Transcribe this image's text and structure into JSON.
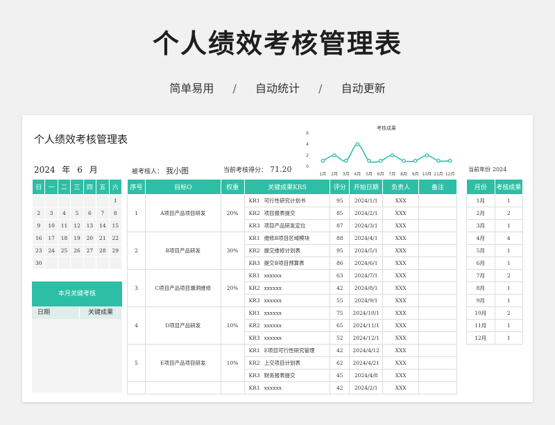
{
  "hero": {
    "title": "个人绩效考核管理表",
    "tag1": "简单易用",
    "tag2": "自动统计",
    "tag3": "自动更新",
    "sep": "/"
  },
  "sheet": {
    "title": "个人绩效考核管理表",
    "year": "2024",
    "year_unit": "年",
    "month": "6",
    "month_unit": "月",
    "assessee_label": "被考核人：",
    "assessee": "我小图",
    "score_label": "当前考核得分：",
    "score": "71.20",
    "curyear_label": "当前年份",
    "curyear": "2024"
  },
  "chart_data": {
    "type": "line",
    "title": "考核成果",
    "categories": [
      "1月",
      "2月",
      "3月",
      "4月",
      "5月",
      "6月",
      "7月",
      "8月",
      "9月",
      "10月",
      "11月",
      "12月"
    ],
    "values": [
      1,
      2,
      1,
      4,
      1,
      1,
      2,
      1,
      1,
      2,
      1,
      1
    ],
    "ylim": [
      0,
      6
    ],
    "yticks": [
      "0",
      "2",
      "4",
      "6"
    ],
    "color": "#2dbfa5"
  },
  "calendar": {
    "headers": [
      "日",
      "一",
      "二",
      "三",
      "四",
      "五",
      "六"
    ],
    "weeks": [
      [
        "",
        "",
        "",
        "",
        "",
        "",
        "1"
      ],
      [
        "2",
        "3",
        "4",
        "5",
        "6",
        "7",
        "8"
      ],
      [
        "9",
        "10",
        "11",
        "12",
        "13",
        "14",
        "15"
      ],
      [
        "16",
        "17",
        "18",
        "19",
        "20",
        "21",
        "22"
      ],
      [
        "23",
        "24",
        "25",
        "26",
        "27",
        "28",
        "29"
      ],
      [
        "30",
        "",
        "",
        "",
        "",
        "",
        ""
      ]
    ]
  },
  "kpi_box": {
    "title": "本月关键考核",
    "col_date": "日期",
    "col_result": "关键成果"
  },
  "main_table": {
    "headers": [
      "序号",
      "目标O",
      "权重",
      "关键成果KRS",
      "评分",
      "开始日期",
      "负责人",
      "备注"
    ],
    "objectives": [
      {
        "no": "1",
        "name": "A项目产品项目研发",
        "weight": "20%",
        "krs": [
          {
            "kr": "KR1",
            "text": "可行性研究计划书",
            "score": "95",
            "date": "2024/1/1",
            "owner": "XXX"
          },
          {
            "kr": "KR2",
            "text": "项目报表提交",
            "score": "85",
            "date": "2024/2/1",
            "owner": "XXX"
          },
          {
            "kr": "KR3",
            "text": "项目产品研发定位",
            "score": "87",
            "date": "2024/3/1",
            "owner": "XXX"
          }
        ]
      },
      {
        "no": "2",
        "name": "B项目产品研发",
        "weight": "30%",
        "krs": [
          {
            "kr": "KR1",
            "text": "维修B项目区域模块",
            "score": "88",
            "date": "2024/4/1",
            "owner": "XXX"
          },
          {
            "kr": "KR2",
            "text": "提交维修计划表",
            "score": "95",
            "date": "2024/5/1",
            "owner": "XXX"
          },
          {
            "kr": "KR3",
            "text": "提交B项目预算表",
            "score": "86",
            "date": "2024/6/1",
            "owner": "XXX"
          }
        ]
      },
      {
        "no": "3",
        "name": "C项目产品项目漏洞维修",
        "weight": "20%",
        "krs": [
          {
            "kr": "KR1",
            "text": "xxxxxx",
            "score": "63",
            "date": "2024/7/1",
            "owner": "XXX"
          },
          {
            "kr": "KR2",
            "text": "xxxxxx",
            "score": "42",
            "date": "2024/8/1",
            "owner": "XXX"
          },
          {
            "kr": "KR3",
            "text": "xxxxxx",
            "score": "55",
            "date": "2024/9/1",
            "owner": "XXX"
          }
        ]
      },
      {
        "no": "4",
        "name": "D项目产品研发",
        "weight": "10%",
        "krs": [
          {
            "kr": "KR1",
            "text": "xxxxxx",
            "score": "75",
            "date": "2024/10/1",
            "owner": "XXX"
          },
          {
            "kr": "KR2",
            "text": "xxxxxx",
            "score": "65",
            "date": "2024/11/1",
            "owner": "XXX"
          },
          {
            "kr": "KR3",
            "text": "xxxxxx",
            "score": "52",
            "date": "2024/12/1",
            "owner": "XXX"
          }
        ]
      },
      {
        "no": "5",
        "name": "E项目产品项目研发",
        "weight": "10%",
        "krs": [
          {
            "kr": "KR1",
            "text": "E项目可行性研究管理",
            "score": "42",
            "date": "2024/4/12",
            "owner": "XXX"
          },
          {
            "kr": "KR2",
            "text": "上交项目计划表",
            "score": "62",
            "date": "2024/4/21",
            "owner": "XXX"
          },
          {
            "kr": "KR3",
            "text": "财务报表提交",
            "score": "45",
            "date": "2024/4/8",
            "owner": "XXX"
          }
        ]
      },
      {
        "no": "",
        "name": "",
        "weight": "",
        "krs": [
          {
            "kr": "KR1",
            "text": "xxxxxx",
            "score": "42",
            "date": "2024/2/1",
            "owner": "XXX"
          }
        ]
      }
    ]
  },
  "monthly_table": {
    "headers": [
      "月份",
      "考核成果"
    ],
    "rows": [
      [
        "1月",
        "1"
      ],
      [
        "2月",
        "2"
      ],
      [
        "3月",
        "1"
      ],
      [
        "4月",
        "4"
      ],
      [
        "5月",
        "1"
      ],
      [
        "6月",
        "1"
      ],
      [
        "7月",
        "2"
      ],
      [
        "8月",
        "1"
      ],
      [
        "9月",
        "1"
      ],
      [
        "10月",
        "2"
      ],
      [
        "11月",
        "1"
      ],
      [
        "12月",
        "1"
      ]
    ]
  }
}
